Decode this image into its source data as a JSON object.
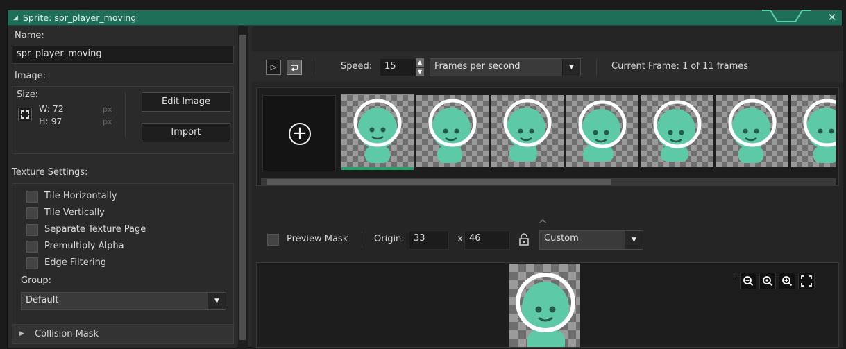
{
  "window": {
    "title": "Sprite: spr_player_moving",
    "close_label": "✕"
  },
  "left": {
    "name_label": "Name:",
    "name_value": "spr_player_moving",
    "image_label": "Image:",
    "size_label": "Size:",
    "width_label": "W: 72",
    "height_label": "H: 97",
    "unit_label": "px",
    "edit_image_label": "Edit Image",
    "import_label": "Import",
    "texture_settings_label": "Texture Settings:",
    "options": [
      {
        "label": "Tile Horizontally",
        "checked": false
      },
      {
        "label": "Tile Vertically",
        "checked": false
      },
      {
        "label": "Separate Texture Page",
        "checked": false
      },
      {
        "label": "Premultiply Alpha",
        "checked": false
      },
      {
        "label": "Edge Filtering",
        "checked": false
      }
    ],
    "group_label": "Group:",
    "group_value": "Default",
    "collision_mask_label": "Collision Mask"
  },
  "toolbar": {
    "play_icon": "play-icon",
    "loop_icon": "loop-icon",
    "speed_label": "Speed:",
    "speed_value": "15",
    "speed_unit": "Frames per second",
    "current_frame_label": "Current Frame: 1 of 11 frames"
  },
  "frames": {
    "count_visible": 7,
    "selected_index": 0
  },
  "mask": {
    "preview_mask_label": "Preview Mask",
    "origin_label": "Origin:",
    "origin_x": "33",
    "origin_sep": "x",
    "origin_y": "46",
    "origin_mode": "Custom"
  },
  "colors": {
    "accent": "#1e6e58",
    "selection": "#1aa56a",
    "sprite": "#5ec9a6"
  }
}
